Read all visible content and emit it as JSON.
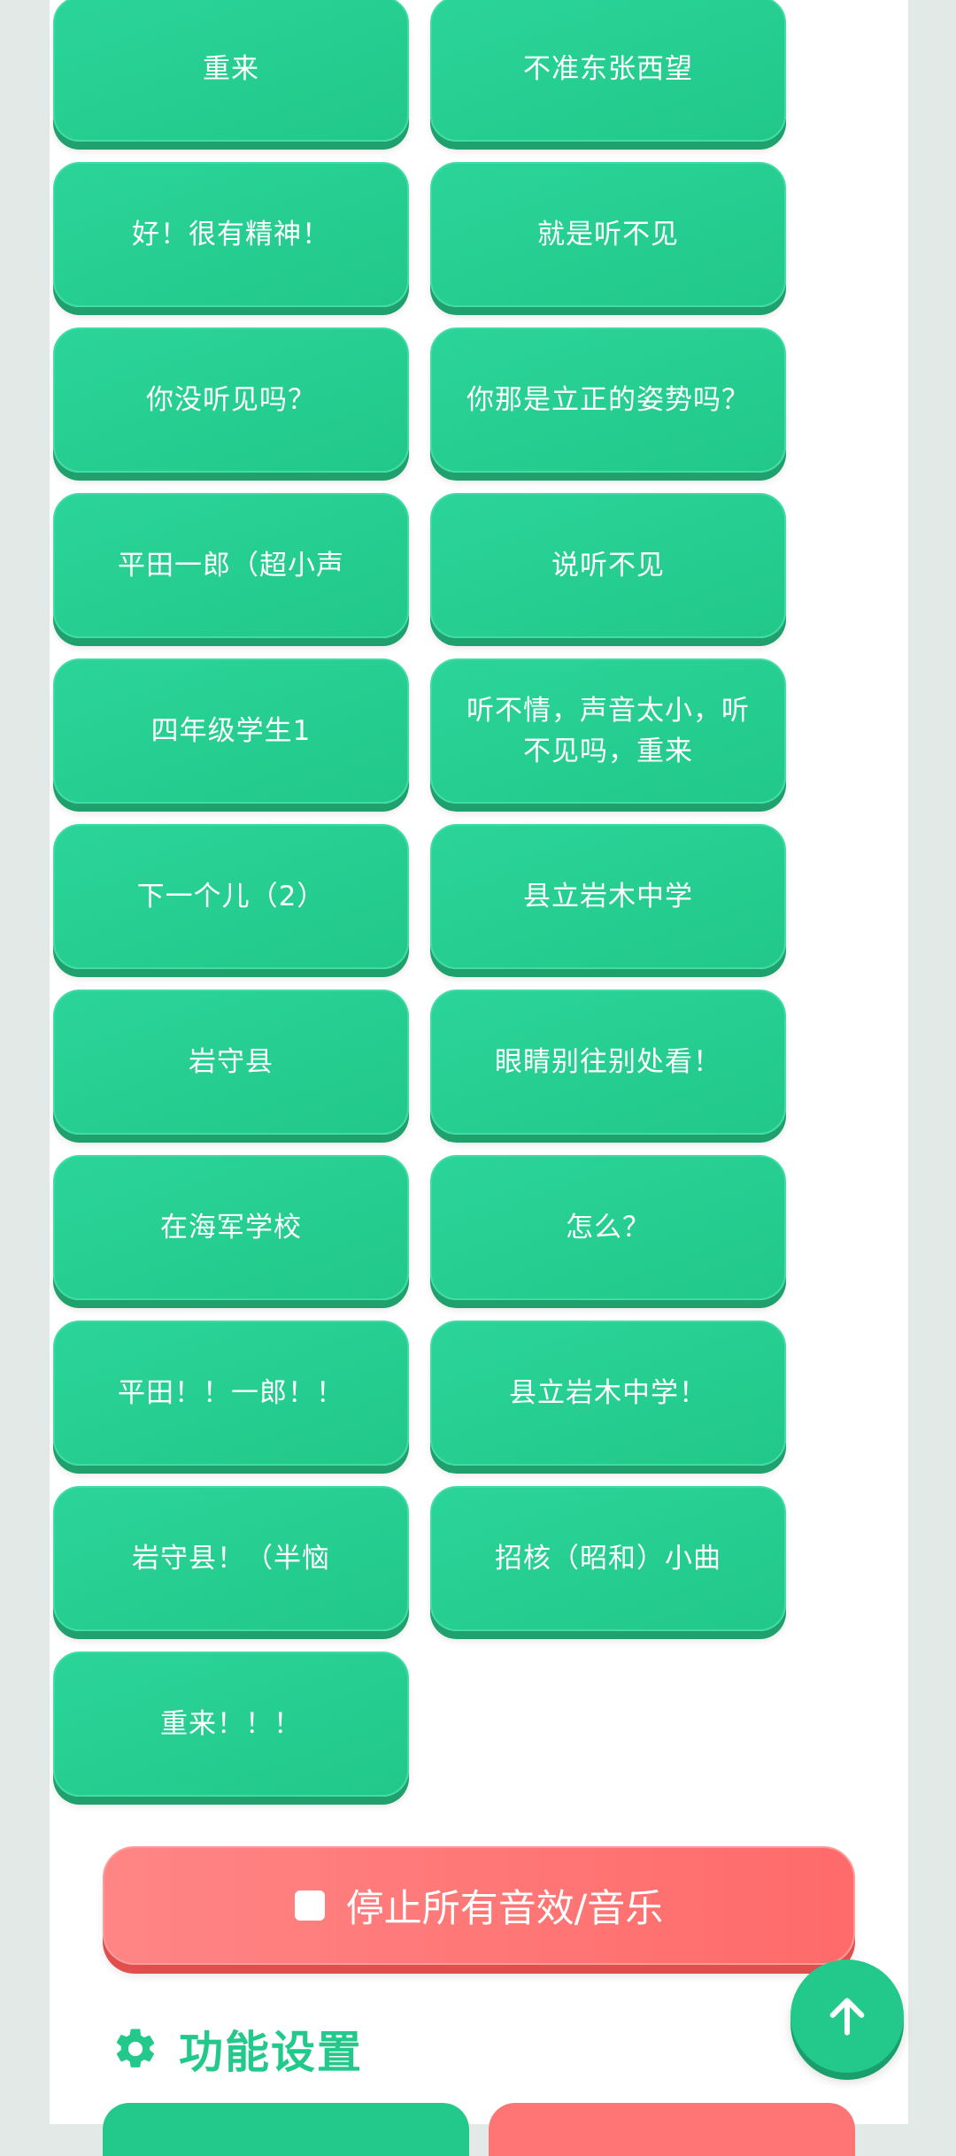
{
  "sound_buttons": [
    "重来",
    "不准东张西望",
    "好！很有精神！",
    "就是听不见",
    "你没听见吗？",
    "你那是立正的姿势吗？",
    "平田一郎（超小声",
    "说听不见",
    "四年级学生1",
    "听不情，声音太小，听不见吗，重来",
    "下一个儿（2）",
    "县立岩木中学",
    "岩守县",
    "眼睛别往别处看！",
    "在海军学校",
    "怎么？",
    "平田！！一郎！！",
    "县立岩木中学！",
    "岩守县！（半恼",
    "招核（昭和）小曲",
    "重来！！！"
  ],
  "stop_button": {
    "icon": "stop-square-icon",
    "label": "停止所有音效/音乐"
  },
  "settings_section": {
    "icon": "gear-icon",
    "title": "功能设置"
  },
  "scroll_top_button": {
    "icon": "arrow-up-icon"
  },
  "colors": {
    "primary_green": "#22c98b",
    "button_shadow_green": "#1fa06c",
    "stop_red": "#ff6f6f",
    "background": "#e3e9e7"
  }
}
